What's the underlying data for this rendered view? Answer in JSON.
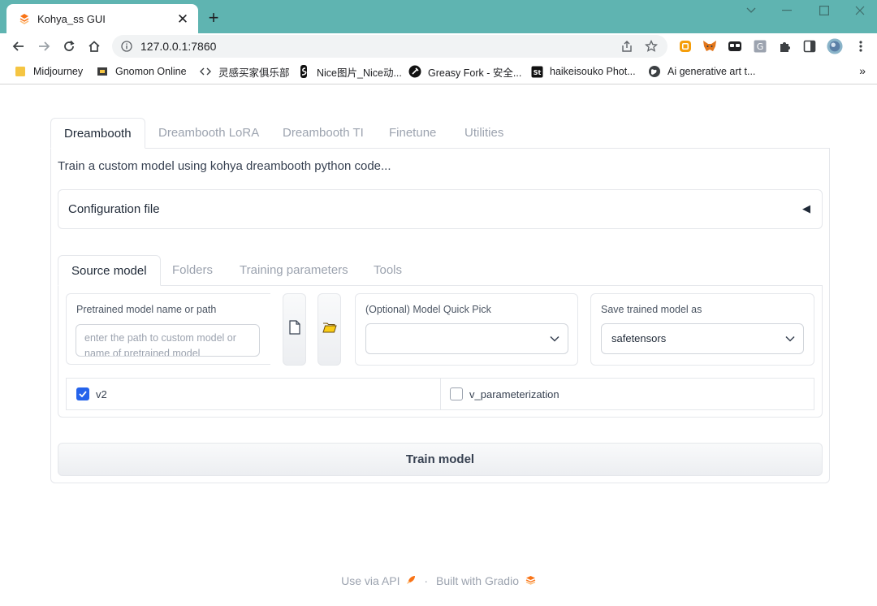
{
  "browser": {
    "tab_title": "Kohya_ss GUI",
    "url": "127.0.0.1:7860",
    "bookmarks": [
      {
        "label": "Midjourney",
        "icon": "folder-icon"
      },
      {
        "label": "Gnomon Online",
        "icon": "gnomon-icon"
      },
      {
        "label": "灵感买家俱乐部",
        "icon": "bracket-icon"
      },
      {
        "label": "Nice图片_Nice动...",
        "icon": "nice-icon"
      },
      {
        "label": "Greasy Fork - 安全...",
        "icon": "greasyfork-icon"
      },
      {
        "label": "haikeisouko Phot...",
        "icon": "haikeisouko-icon"
      },
      {
        "label": "Ai generative art t...",
        "icon": "globe-icon"
      }
    ],
    "more": "»"
  },
  "app": {
    "tabs": [
      "Dreambooth",
      "Dreambooth LoRA",
      "Dreambooth TI",
      "Finetune",
      "Utilities"
    ],
    "description": "Train a custom model using kohya dreambooth python code...",
    "config_label": "Configuration file",
    "config_arrow": "◀",
    "inner_tabs": [
      "Source model",
      "Folders",
      "Training parameters",
      "Tools"
    ],
    "pretrained_label": "Pretrained model name or path",
    "pretrained_placeholder": "enter the path to custom model or name of pretrained model",
    "quick_pick_label": "(Optional) Model Quick Pick",
    "quick_pick_value": "",
    "save_as_label": "Save trained model as",
    "save_as_value": "safetensors",
    "v2_label": "v2",
    "v2_checked": true,
    "vparam_label": "v_parameterization",
    "vparam_checked": false,
    "train_button": "Train model",
    "accent_color": "#2563eb"
  },
  "footer": {
    "api": "Use via API",
    "separator": "·",
    "built": "Built with Gradio"
  }
}
